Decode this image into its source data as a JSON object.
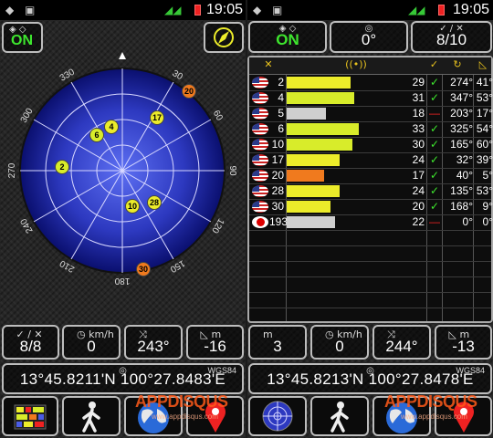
{
  "status_bar": {
    "time": "19:05"
  },
  "left": {
    "gps_status": "ON",
    "compass_labels": [
      "330",
      "30",
      "300",
      "60",
      "270",
      "90",
      "240",
      "120",
      "210",
      "150",
      "180"
    ],
    "satellites": [
      {
        "prn": "20",
        "color": "#f07a1e"
      },
      {
        "prn": "17",
        "color": "#ecec2a"
      },
      {
        "prn": "6",
        "color": "#d8ec2a"
      },
      {
        "prn": "4",
        "color": "#ecec2a"
      },
      {
        "prn": "2",
        "color": "#d8ec2a"
      },
      {
        "prn": "28",
        "color": "#ecec2a"
      },
      {
        "prn": "10",
        "color": "#ecec2a"
      },
      {
        "prn": "30",
        "color": "#f07a1e"
      }
    ],
    "stats": [
      {
        "label": "✓ / ✕",
        "value": "8/8"
      },
      {
        "label": "km/h",
        "value": "0"
      },
      {
        "label": "",
        "value": "243°"
      },
      {
        "label": "m",
        "value": "-16"
      }
    ],
    "coordinates": {
      "datum": "WGS84",
      "text": "13°45.8211'N   100°27.8483'E"
    }
  },
  "right": {
    "top": [
      {
        "value": "ON"
      },
      {
        "value": "0°"
      },
      {
        "label": "✓ / ✕",
        "value": "8/10"
      }
    ],
    "table": {
      "headers": [
        "sat",
        "snr",
        "used",
        "az",
        "el"
      ],
      "rows": [
        {
          "prn": "2",
          "snr": "29",
          "used": "✓",
          "az": "274°",
          "el": "41°",
          "flag": "us",
          "snr_fraction": 0.58,
          "color": "#ecec2a"
        },
        {
          "prn": "4",
          "snr": "31",
          "used": "✓",
          "az": "347°",
          "el": "53°",
          "flag": "us",
          "snr_fraction": 0.62,
          "color": "#d8ec2a"
        },
        {
          "prn": "5",
          "snr": "18",
          "used": "—",
          "az": "203°",
          "el": "17°",
          "flag": "us",
          "snr_fraction": 0.36,
          "color": "#cfcfcf"
        },
        {
          "prn": "6",
          "snr": "33",
          "used": "✓",
          "az": "325°",
          "el": "54°",
          "flag": "us",
          "snr_fraction": 0.66,
          "color": "#d8ec2a"
        },
        {
          "prn": "10",
          "snr": "30",
          "used": "✓",
          "az": "165°",
          "el": "60°",
          "flag": "us",
          "snr_fraction": 0.6,
          "color": "#d8ec2a"
        },
        {
          "prn": "17",
          "snr": "24",
          "used": "✓",
          "az": "32°",
          "el": "39°",
          "flag": "us",
          "snr_fraction": 0.48,
          "color": "#ecec2a"
        },
        {
          "prn": "20",
          "snr": "17",
          "used": "✓",
          "az": "40°",
          "el": "5°",
          "flag": "us",
          "snr_fraction": 0.34,
          "color": "#f07a1e"
        },
        {
          "prn": "28",
          "snr": "24",
          "used": "✓",
          "az": "135°",
          "el": "53°",
          "flag": "us",
          "snr_fraction": 0.48,
          "color": "#ecec2a"
        },
        {
          "prn": "30",
          "snr": "20",
          "used": "✓",
          "az": "168°",
          "el": "9°",
          "flag": "us",
          "snr_fraction": 0.4,
          "color": "#ecec2a"
        },
        {
          "prn": "193",
          "snr": "22",
          "used": "—",
          "az": "0°",
          "el": "0°",
          "flag": "jp",
          "snr_fraction": 0.44,
          "color": "#cfcfcf"
        }
      ]
    },
    "stats": [
      {
        "label": "m",
        "value": "3"
      },
      {
        "label": "km/h",
        "value": "0"
      },
      {
        "label": "",
        "value": "244°"
      },
      {
        "label": "m",
        "value": "-13"
      }
    ],
    "coordinates": {
      "datum": "WGS84",
      "text": "13°45.8213'N   100°27.8478'E"
    }
  },
  "watermark": {
    "brand": "APPDISQUS",
    "url": "www.appdisqus.com"
  },
  "icons": {
    "gps_toggle": "gps-satellite-icon",
    "compass": "compass-icon",
    "signal_bars_nav": "signal-bars-icon",
    "walk": "pedestrian-icon",
    "globe": "globe-icon",
    "pin": "map-pin-icon",
    "radar": "radar-icon"
  },
  "colors": {
    "status_on": "#3ee62e",
    "check": "#3ee62e",
    "dash": "#e22",
    "header_icon": "#e8c21e",
    "sky_center": "#4a5ce6",
    "sky_edge": "#0a0f6e"
  }
}
